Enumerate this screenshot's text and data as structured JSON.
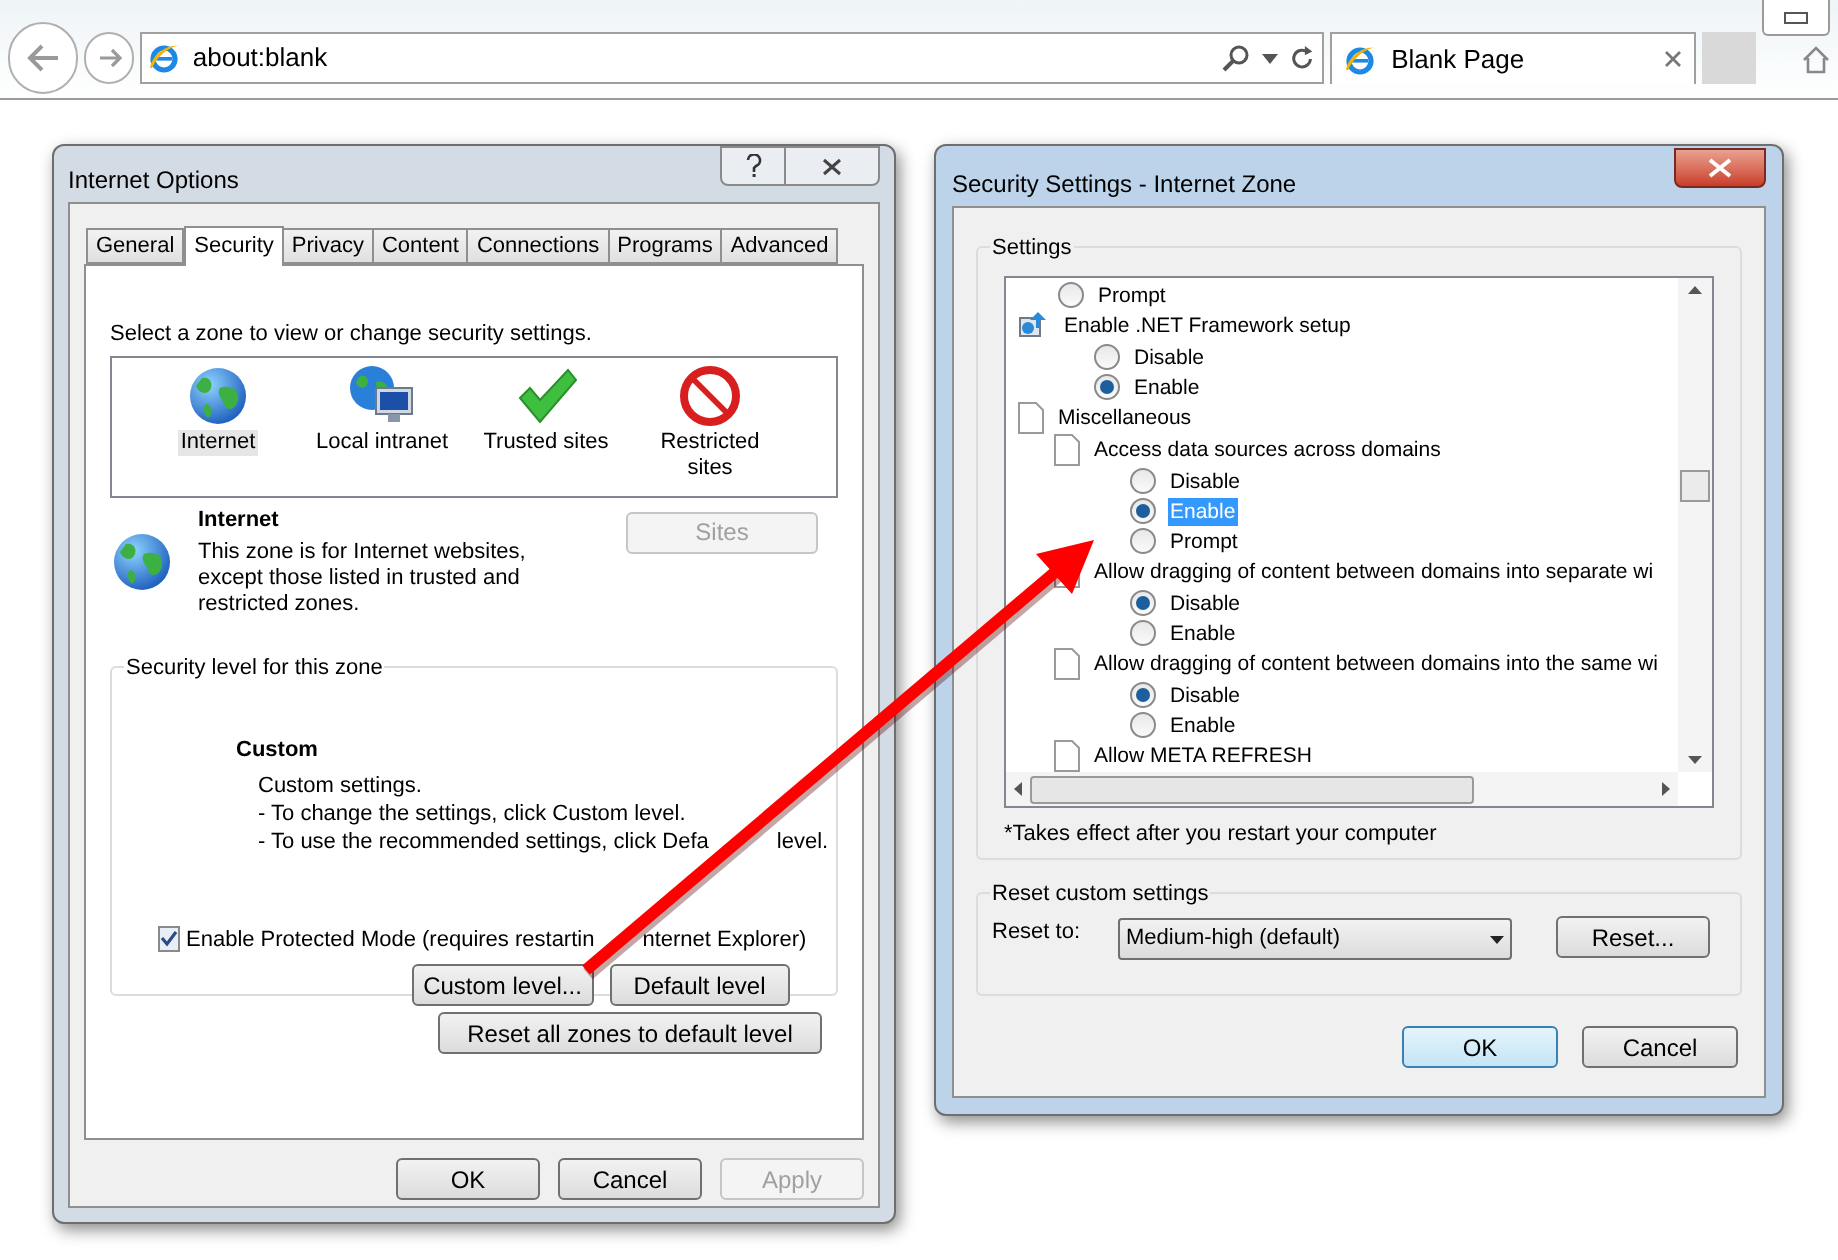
{
  "browser": {
    "address": "about:blank",
    "tab": {
      "title": "Blank Page",
      "selected": true
    }
  },
  "internet_options": {
    "title": "Internet Options",
    "tabs": [
      {
        "label": "General",
        "selected": false
      },
      {
        "label": "Security",
        "selected": true
      },
      {
        "label": "Privacy",
        "selected": false
      },
      {
        "label": "Content",
        "selected": false
      },
      {
        "label": "Connections",
        "selected": false
      },
      {
        "label": "Programs",
        "selected": false
      },
      {
        "label": "Advanced",
        "selected": false
      }
    ],
    "zone_prompt": "Select a zone to view or change security settings.",
    "zones": [
      {
        "kind": "globe",
        "label": "Internet",
        "selected": true
      },
      {
        "kind": "intranet",
        "label": "Local intranet",
        "selected": false
      },
      {
        "kind": "check",
        "label": "Trusted sites",
        "selected": false
      },
      {
        "kind": "blocked",
        "label": "Restricted sites",
        "selected": false
      }
    ],
    "zone_name": "Internet",
    "zone_description": "This zone is for Internet websites, except those listed in trusted and restricted zones.",
    "sites_button": {
      "label": "Sites",
      "disabled": true
    },
    "level_group": "Security level for this zone",
    "level_name": "Custom",
    "level_lines": [
      [
        "Custom settings."
      ],
      [
        "- To change the settings, click Custom level."
      ],
      [
        "- To use the recommended settings, click Defa",
        "level."
      ]
    ],
    "protected_mode": {
      "label_parts": [
        "Enable Protected Mode (requires restartin",
        "nternet Explorer)"
      ],
      "checked": true
    },
    "level_buttons": [
      {
        "label": "Custom level...",
        "disabled": false
      },
      {
        "label": "Default level",
        "disabled": false
      }
    ],
    "reset_all": {
      "label": "Reset all zones to default level",
      "disabled": false
    },
    "buttons": [
      {
        "label": "OK",
        "disabled": false
      },
      {
        "label": "Cancel",
        "disabled": false
      },
      {
        "label": "Apply",
        "disabled": true
      }
    ]
  },
  "security_settings": {
    "title": "Security Settings - Internet Zone",
    "group": "Settings",
    "items": [
      {
        "kind": "radio",
        "label": "Prompt",
        "selected": false
      },
      {
        "kind": "setting",
        "label": "Enable .NET Framework setup",
        "children": [
          {
            "kind": "radio",
            "label": "Disable",
            "selected": false
          },
          {
            "kind": "radio",
            "label": "Enable",
            "selected": true
          }
        ]
      },
      {
        "kind": "category",
        "label": "Miscellaneous",
        "children": [
          {
            "kind": "setting",
            "label": "Access data sources across domains",
            "children": [
              {
                "kind": "radio",
                "label": "Disable",
                "selected": false
              },
              {
                "kind": "radio",
                "label": "Enable",
                "selected": true,
                "highlighted": true
              },
              {
                "kind": "radio",
                "label": "Prompt",
                "selected": false
              }
            ]
          },
          {
            "kind": "setting",
            "label": "Allow dragging of content between domains into separate wi",
            "children": [
              {
                "kind": "radio",
                "label": "Disable",
                "selected": true
              },
              {
                "kind": "radio",
                "label": "Enable",
                "selected": false
              }
            ]
          },
          {
            "kind": "setting",
            "label": "Allow dragging of content between domains into the same wi",
            "children": [
              {
                "kind": "radio",
                "label": "Disable",
                "selected": true
              },
              {
                "kind": "radio",
                "label": "Enable",
                "selected": false
              }
            ]
          },
          {
            "kind": "setting",
            "label": "Allow META REFRESH"
          }
        ]
      }
    ],
    "footnote": "*Takes effect after you restart your computer",
    "reset_group": "Reset custom settings",
    "reset_label": "Reset to:",
    "reset_value": "Medium-high (default)",
    "reset_button": "Reset...",
    "buttons": [
      {
        "label": "OK",
        "default": true
      },
      {
        "label": "Cancel",
        "default": false
      }
    ]
  }
}
